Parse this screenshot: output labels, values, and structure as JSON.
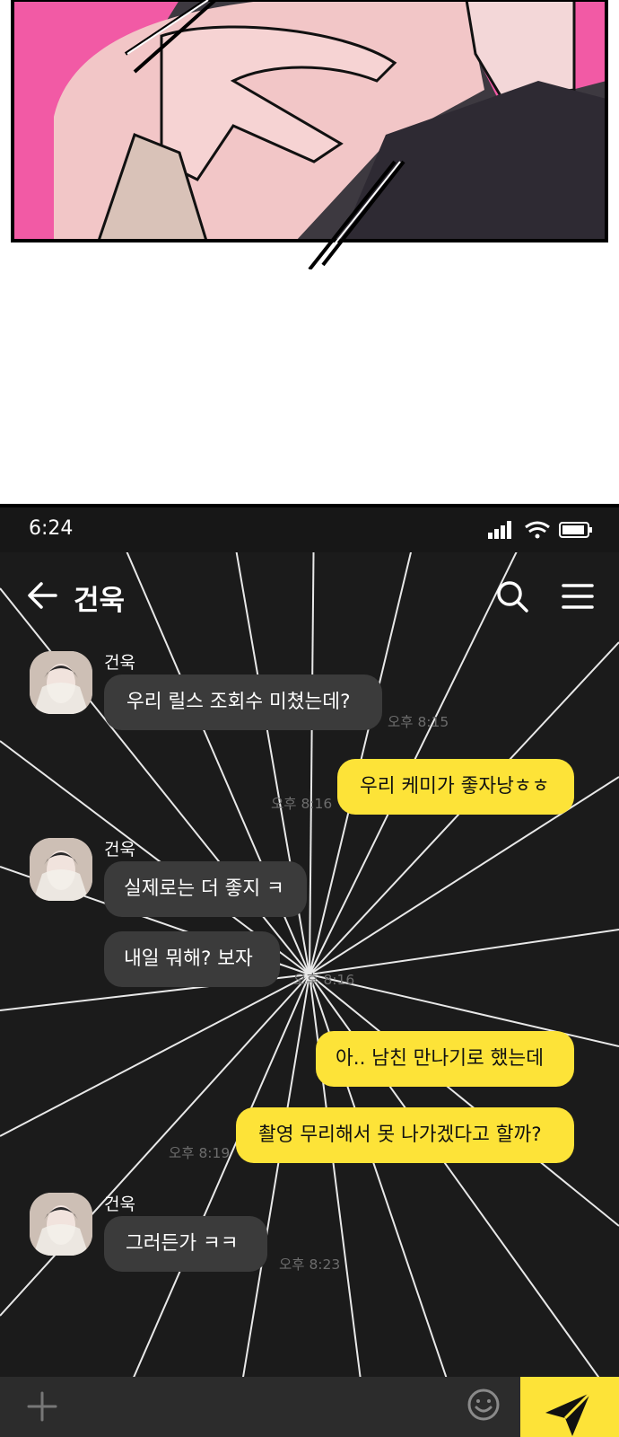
{
  "status_bar": {
    "time": "6:24"
  },
  "header": {
    "title": "건욱"
  },
  "messages": [
    {
      "sender": "건욱",
      "text": "우리 릴스 조회수 미쳤는데?",
      "time": "오후 8:15"
    },
    {
      "text": "우리 케미가 좋자낭ㅎㅎ",
      "time": "오후 8:16"
    },
    {
      "sender": "건욱",
      "text": "실제로는 더 좋지 ㅋ"
    },
    {
      "text": "내일 뭐해? 보자",
      "time": "오후 8:16"
    },
    {
      "text": "아.. 남친 만나기로 했는데"
    },
    {
      "text": "촬영 무리해서 못 나가겠다고 할까?",
      "time": "오후 8:19"
    },
    {
      "sender": "건욱",
      "text": "그러든가 ㅋㅋ",
      "time": "오후 8:23"
    }
  ],
  "colors": {
    "bubble_out": "#fde338",
    "bubble_in": "#3b3b3b",
    "background": "#1b1b1b"
  }
}
